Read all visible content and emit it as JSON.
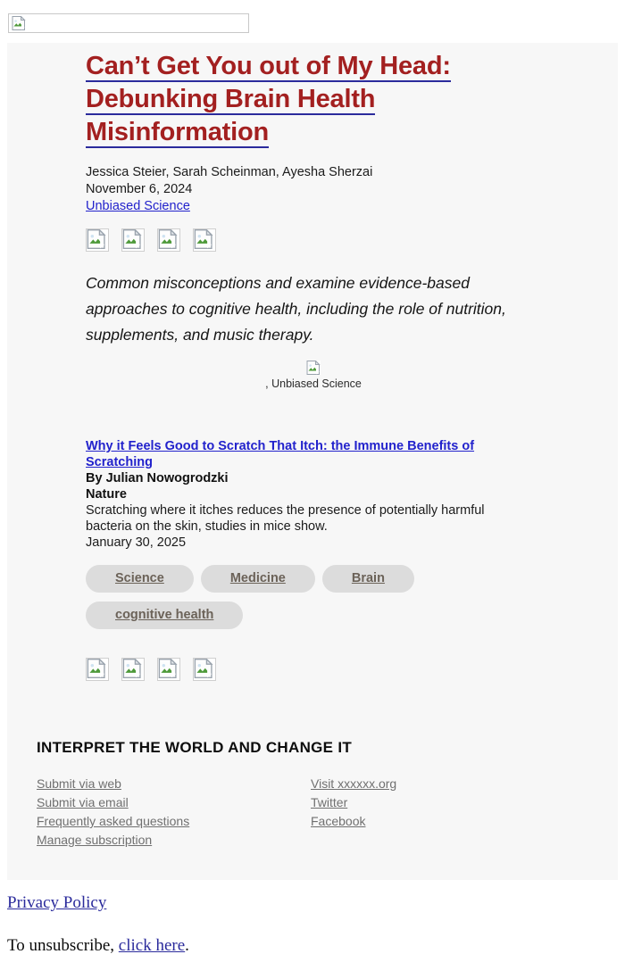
{
  "banner": {
    "icon": "broken-image-icon"
  },
  "feature": {
    "headline": "Can’t Get You out of My Head: Debunking Brain Health Misinformation",
    "authors": "Jessica Steier, Sarah Scheinman, Ayesha Sherzai",
    "date": "November 6, 2024",
    "source": "Unbiased Science",
    "summary": "Common misconceptions and examine evidence-based approaches to cognitive health, including the role of nutrition, supplements, and music therapy.",
    "caption": ", Unbiased Science",
    "thumbnails": [
      "broken-image-icon",
      "broken-image-icon",
      "broken-image-icon",
      "broken-image-icon"
    ]
  },
  "article": {
    "title": "Why it Feels Good to Scratch That Itch: the Immune Benefits of Scratching",
    "author": "By Julian Nowogrodzki",
    "publication": "Nature",
    "description": "Scratching where it itches reduces the presence of potentially harmful bacteria on the skin, studies in mice show.",
    "date": "January 30, 2025",
    "tags": [
      "Science",
      "Medicine",
      "Brain",
      "cognitive health"
    ]
  },
  "social": {
    "icons": [
      "broken-image-icon",
      "broken-image-icon",
      "broken-image-icon",
      "broken-image-icon"
    ]
  },
  "footer": {
    "title": "INTERPRET THE WORLD AND CHANGE IT",
    "left_links": [
      "Submit via web",
      "Submit via email",
      "Frequently asked questions",
      "Manage subscription"
    ],
    "right_links": [
      "Visit xxxxxx.org",
      "Twitter",
      "Facebook"
    ]
  },
  "legal": {
    "privacy_policy": "Privacy Policy",
    "unsubscribe_prefix": "To unsubscribe, ",
    "unsubscribe_link": "click here",
    "unsubscribe_suffix": "."
  },
  "colors": {
    "headline": "#a32020",
    "link_blue": "#2222cc",
    "underline_navy": "#2b2b9c",
    "tag_bg": "#dcdcdc",
    "tag_text": "#6b6258",
    "panel_bg": "#f7f7f7",
    "footer_link": "#707070"
  }
}
